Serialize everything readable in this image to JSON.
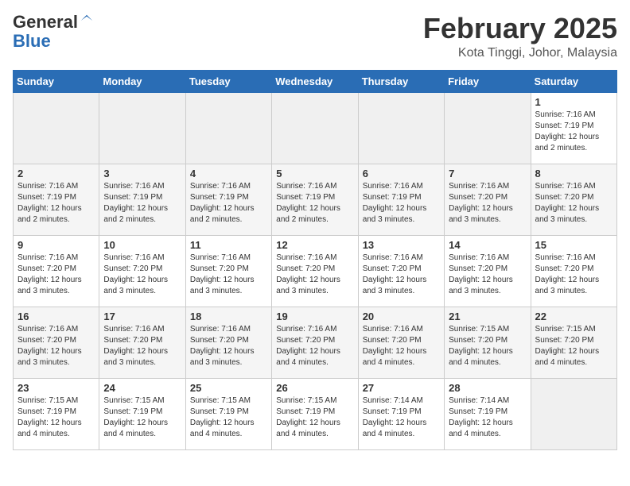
{
  "header": {
    "logo_general": "General",
    "logo_blue": "Blue",
    "month_title": "February 2025",
    "location": "Kota Tinggi, Johor, Malaysia"
  },
  "days_of_week": [
    "Sunday",
    "Monday",
    "Tuesday",
    "Wednesday",
    "Thursday",
    "Friday",
    "Saturday"
  ],
  "weeks": [
    [
      {
        "day": "",
        "info": ""
      },
      {
        "day": "",
        "info": ""
      },
      {
        "day": "",
        "info": ""
      },
      {
        "day": "",
        "info": ""
      },
      {
        "day": "",
        "info": ""
      },
      {
        "day": "",
        "info": ""
      },
      {
        "day": "1",
        "info": "Sunrise: 7:16 AM\nSunset: 7:19 PM\nDaylight: 12 hours\nand 2 minutes."
      }
    ],
    [
      {
        "day": "2",
        "info": "Sunrise: 7:16 AM\nSunset: 7:19 PM\nDaylight: 12 hours\nand 2 minutes."
      },
      {
        "day": "3",
        "info": "Sunrise: 7:16 AM\nSunset: 7:19 PM\nDaylight: 12 hours\nand 2 minutes."
      },
      {
        "day": "4",
        "info": "Sunrise: 7:16 AM\nSunset: 7:19 PM\nDaylight: 12 hours\nand 2 minutes."
      },
      {
        "day": "5",
        "info": "Sunrise: 7:16 AM\nSunset: 7:19 PM\nDaylight: 12 hours\nand 2 minutes."
      },
      {
        "day": "6",
        "info": "Sunrise: 7:16 AM\nSunset: 7:19 PM\nDaylight: 12 hours\nand 3 minutes."
      },
      {
        "day": "7",
        "info": "Sunrise: 7:16 AM\nSunset: 7:20 PM\nDaylight: 12 hours\nand 3 minutes."
      },
      {
        "day": "8",
        "info": "Sunrise: 7:16 AM\nSunset: 7:20 PM\nDaylight: 12 hours\nand 3 minutes."
      }
    ],
    [
      {
        "day": "9",
        "info": "Sunrise: 7:16 AM\nSunset: 7:20 PM\nDaylight: 12 hours\nand 3 minutes."
      },
      {
        "day": "10",
        "info": "Sunrise: 7:16 AM\nSunset: 7:20 PM\nDaylight: 12 hours\nand 3 minutes."
      },
      {
        "day": "11",
        "info": "Sunrise: 7:16 AM\nSunset: 7:20 PM\nDaylight: 12 hours\nand 3 minutes."
      },
      {
        "day": "12",
        "info": "Sunrise: 7:16 AM\nSunset: 7:20 PM\nDaylight: 12 hours\nand 3 minutes."
      },
      {
        "day": "13",
        "info": "Sunrise: 7:16 AM\nSunset: 7:20 PM\nDaylight: 12 hours\nand 3 minutes."
      },
      {
        "day": "14",
        "info": "Sunrise: 7:16 AM\nSunset: 7:20 PM\nDaylight: 12 hours\nand 3 minutes."
      },
      {
        "day": "15",
        "info": "Sunrise: 7:16 AM\nSunset: 7:20 PM\nDaylight: 12 hours\nand 3 minutes."
      }
    ],
    [
      {
        "day": "16",
        "info": "Sunrise: 7:16 AM\nSunset: 7:20 PM\nDaylight: 12 hours\nand 3 minutes."
      },
      {
        "day": "17",
        "info": "Sunrise: 7:16 AM\nSunset: 7:20 PM\nDaylight: 12 hours\nand 3 minutes."
      },
      {
        "day": "18",
        "info": "Sunrise: 7:16 AM\nSunset: 7:20 PM\nDaylight: 12 hours\nand 3 minutes."
      },
      {
        "day": "19",
        "info": "Sunrise: 7:16 AM\nSunset: 7:20 PM\nDaylight: 12 hours\nand 4 minutes."
      },
      {
        "day": "20",
        "info": "Sunrise: 7:16 AM\nSunset: 7:20 PM\nDaylight: 12 hours\nand 4 minutes."
      },
      {
        "day": "21",
        "info": "Sunrise: 7:15 AM\nSunset: 7:20 PM\nDaylight: 12 hours\nand 4 minutes."
      },
      {
        "day": "22",
        "info": "Sunrise: 7:15 AM\nSunset: 7:20 PM\nDaylight: 12 hours\nand 4 minutes."
      }
    ],
    [
      {
        "day": "23",
        "info": "Sunrise: 7:15 AM\nSunset: 7:19 PM\nDaylight: 12 hours\nand 4 minutes."
      },
      {
        "day": "24",
        "info": "Sunrise: 7:15 AM\nSunset: 7:19 PM\nDaylight: 12 hours\nand 4 minutes."
      },
      {
        "day": "25",
        "info": "Sunrise: 7:15 AM\nSunset: 7:19 PM\nDaylight: 12 hours\nand 4 minutes."
      },
      {
        "day": "26",
        "info": "Sunrise: 7:15 AM\nSunset: 7:19 PM\nDaylight: 12 hours\nand 4 minutes."
      },
      {
        "day": "27",
        "info": "Sunrise: 7:14 AM\nSunset: 7:19 PM\nDaylight: 12 hours\nand 4 minutes."
      },
      {
        "day": "28",
        "info": "Sunrise: 7:14 AM\nSunset: 7:19 PM\nDaylight: 12 hours\nand 4 minutes."
      },
      {
        "day": "",
        "info": ""
      }
    ]
  ]
}
